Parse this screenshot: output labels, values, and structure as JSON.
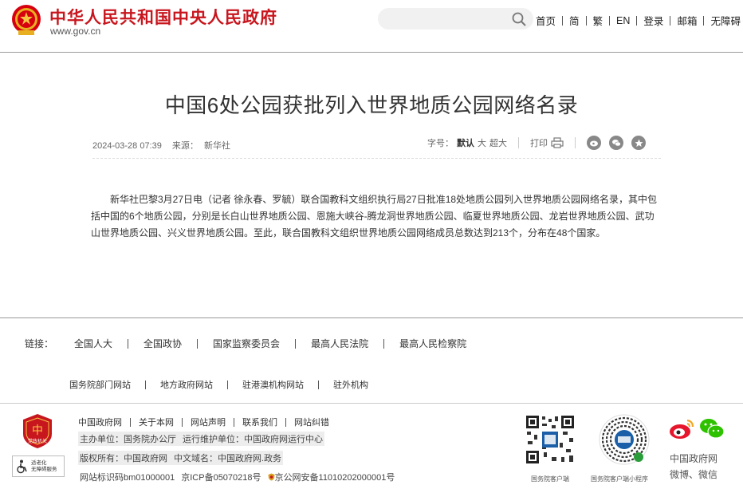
{
  "header": {
    "site_title": "中华人民共和国中央人民政府",
    "site_url": "www.gov.cn",
    "nav": [
      "首页",
      "简",
      "繁",
      "EN",
      "登录",
      "邮箱",
      "无障碍"
    ]
  },
  "article": {
    "title": "中国6处公园获批列入世界地质公园网络名录",
    "date": "2024-03-28 07:39",
    "source_label": "来源：",
    "source": "新华社",
    "font_label": "字号：",
    "font_default": "默认",
    "font_large": "大",
    "font_xlarge": "超大",
    "print_label": "打印",
    "body": "新华社巴黎3月27日电（记者 徐永春、罗毓）联合国教科文组织执行局27日批准18处地质公园列入世界地质公园网络名录，其中包括中国的6个地质公园，分别是长白山世界地质公园、恩施大峡谷-腾龙洞世界地质公园、临夏世界地质公园、龙岩世界地质公园、武功山世界地质公园、兴义世界地质公园。至此，联合国教科文组织世界地质公园网络成员总数达到213个，分布在48个国家。"
  },
  "footer": {
    "links_label": "链接：",
    "links": [
      "全国人大",
      "全国政协",
      "国家监察委员会",
      "最高人民法院",
      "最高人民检察院"
    ],
    "links2": [
      "国务院部门网站",
      "地方政府网站",
      "驻港澳机构网站",
      "驻外机构"
    ],
    "badge_text": "党政机关",
    "accessibility": [
      "适老化",
      "无障碍服务"
    ],
    "nav": [
      "中国政府网",
      "关于本网",
      "网站声明",
      "联系我们",
      "网站纠错"
    ],
    "sponsor": "主办单位：国务院办公厅",
    "operator": "运行维护单位：中国政府网运行中心",
    "copyright": "版权所有：中国政府网",
    "domain": "中文域名：中国政府网.政务",
    "site_id": "网站标识码bm01000001",
    "icp": "京ICP备05070218号",
    "police": "京公网安备11010202000001号",
    "qr1_caption": "国务院客户端",
    "qr2_caption": "国务院客户端小程序",
    "social_caption_1": "中国政府网",
    "social_caption_2": "微博、微信"
  },
  "colors": {
    "brand_red": "#c8161e"
  }
}
